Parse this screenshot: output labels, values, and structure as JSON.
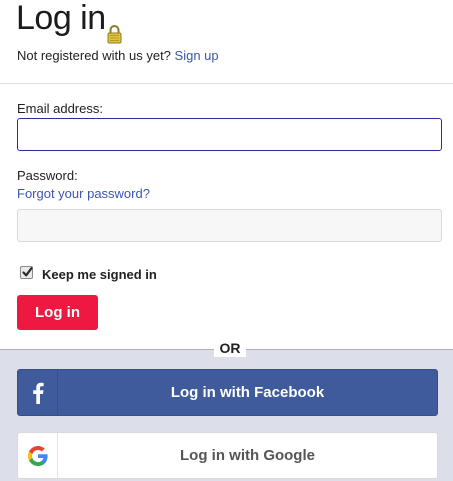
{
  "page": {
    "title": "Log in",
    "subline_text": "Not registered with us yet?",
    "signup_link": "Sign up"
  },
  "form": {
    "email_label": "Email address:",
    "email_value": "",
    "password_label": "Password:",
    "forgot_link": "Forgot your password?",
    "password_value": "",
    "remember_label": "Keep me signed in",
    "remember_checked": true,
    "login_button": "Log in"
  },
  "social": {
    "or_label": "OR",
    "facebook_button": "Log in with Facebook",
    "google_button": "Log in with Google"
  },
  "icons": {
    "title_icon": "lock-icon",
    "facebook_icon": "facebook-icon",
    "google_icon": "google-icon",
    "check_icon": "checkmark-icon"
  },
  "colors": {
    "primary_red": "#ee1942",
    "link_blue": "#3a56b2",
    "facebook_blue": "#3f5b9b",
    "bottom_panel": "#dcdfe9",
    "email_border": "#25309a"
  }
}
